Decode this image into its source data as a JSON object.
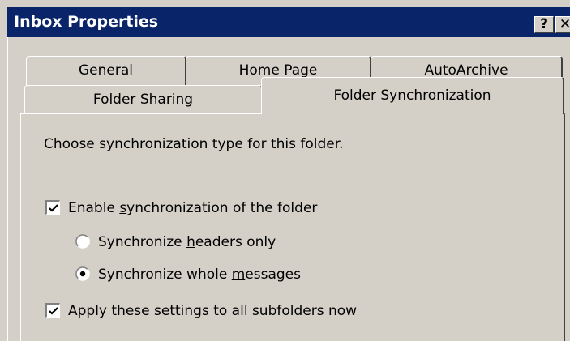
{
  "window": {
    "title": "Inbox Properties",
    "help_glyph": "?",
    "close_glyph": "✕"
  },
  "tabs": {
    "row_back": [
      {
        "label": "General",
        "active": false
      },
      {
        "label": "Home Page",
        "active": false
      },
      {
        "label": "AutoArchive",
        "active": false
      }
    ],
    "row_front": [
      {
        "label": "Folder Sharing",
        "active": false
      },
      {
        "label": "Folder Synchronization",
        "active": true
      }
    ]
  },
  "panel": {
    "description": "Choose synchronization type for this folder.",
    "enable_sync": {
      "label_before": "Enable ",
      "label_mnemonic": "s",
      "label_after": "ynchronization of the folder",
      "checked": true
    },
    "sync_headers": {
      "label_before": "Synchronize ",
      "label_mnemonic": "h",
      "label_after": "eaders only",
      "selected": false
    },
    "sync_whole": {
      "label_before": "Synchronize whole ",
      "label_mnemonic": "m",
      "label_after": "essages",
      "selected": true
    },
    "apply_subfolders": {
      "label": "Apply these settings to all subfolders now",
      "checked": true
    }
  },
  "colors": {
    "titlebar": "#0a246a",
    "face": "#d4d0c8"
  },
  "icons": {
    "check": "check-icon",
    "radio_dot": "radio-dot-icon"
  }
}
